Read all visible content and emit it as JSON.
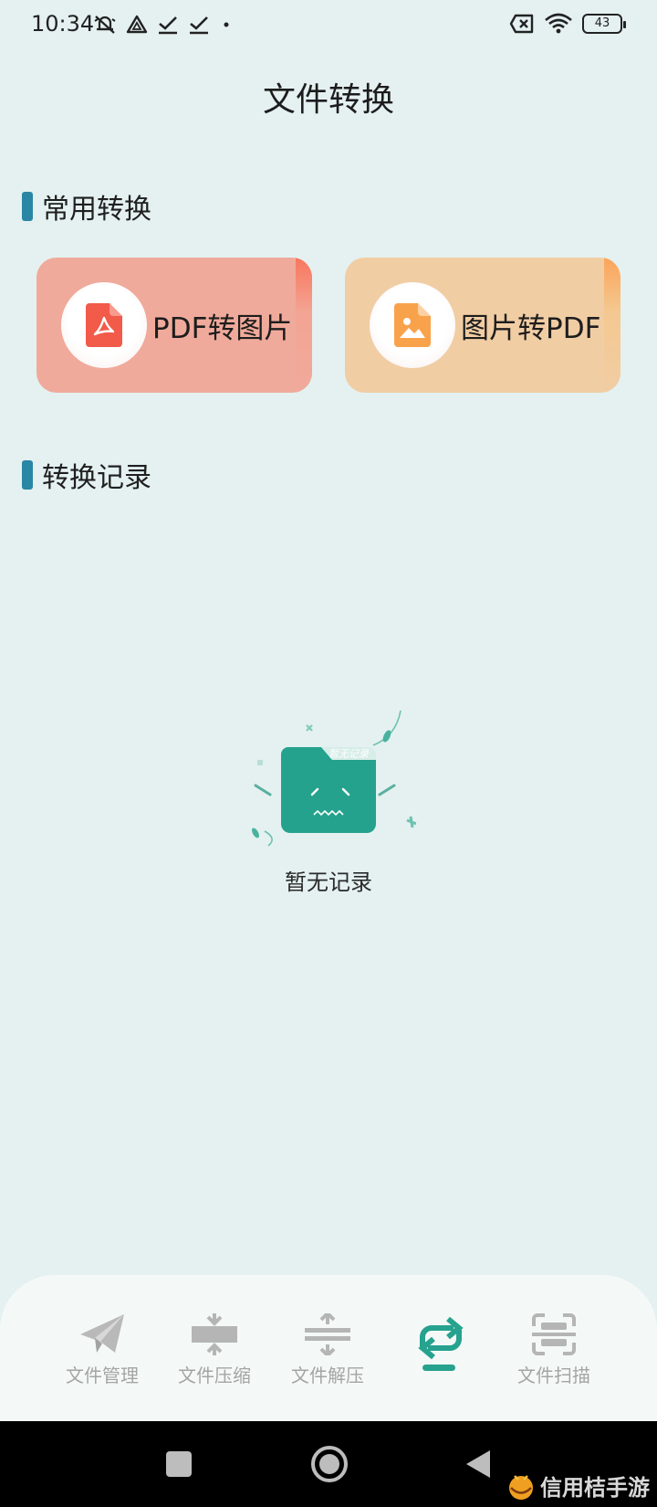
{
  "status_bar": {
    "time": "10:34",
    "battery": "43",
    "icons_left": [
      "mute-bell-icon",
      "drive-icon",
      "download-check-icon",
      "download-check-icon",
      "dot-icon"
    ],
    "icons_right": [
      "sim-off-icon",
      "wifi-icon",
      "battery-icon"
    ]
  },
  "page": {
    "title": "文件转换"
  },
  "sections": {
    "common": "常用转换",
    "records": "转换记录"
  },
  "cards": [
    {
      "label": "PDF转图片",
      "icon": "pdf-file-icon",
      "color": "#f0aa9b",
      "accent": "#f25a4a"
    },
    {
      "label": "图片转PDF",
      "icon": "image-file-icon",
      "color": "#f1cda4",
      "accent": "#f9a24c"
    }
  ],
  "empty": {
    "text": "暂无记录",
    "badge": "暂无记录",
    "illustration": "empty-folder-icon"
  },
  "tabs": [
    {
      "label": "文件管理",
      "icon": "paper-plane-icon",
      "active": false
    },
    {
      "label": "文件压缩",
      "icon": "compress-icon",
      "active": false
    },
    {
      "label": "文件解压",
      "icon": "decompress-icon",
      "active": false
    },
    {
      "label": "",
      "icon": "convert-icon",
      "active": true
    },
    {
      "label": "文件扫描",
      "icon": "scan-icon",
      "active": false
    }
  ],
  "colors": {
    "background": "#e4f1f0",
    "accent": "#26a28e",
    "section_bar": "#2a86a5",
    "tab_inactive": "#a4a4a4"
  },
  "watermark": {
    "text": "信用桔手游"
  }
}
